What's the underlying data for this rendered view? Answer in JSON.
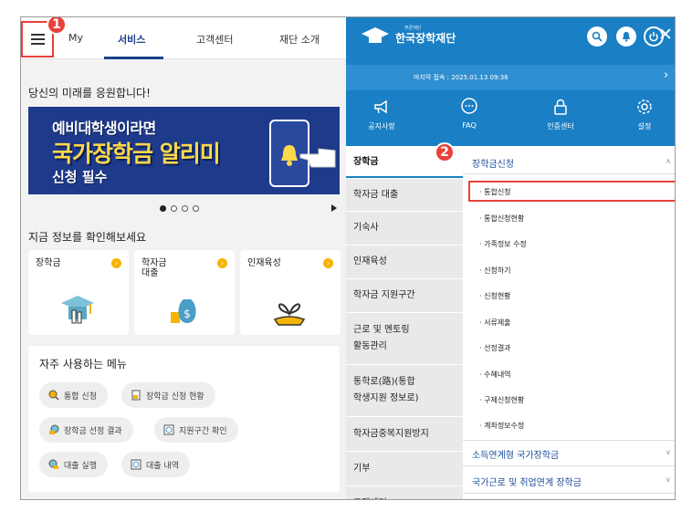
{
  "left": {
    "nav": {
      "tabs": [
        "My",
        "서비스",
        "고객센터",
        "재단 소개"
      ],
      "active": "서비스"
    },
    "step1_badge": "1",
    "headline": "당신의 미래를 응원합니다!",
    "banner": {
      "line1": "예비대학생이라면",
      "line2": "국가장학금 알리미",
      "line3": "신청 필수"
    },
    "carousel": {
      "pages": 4,
      "current": 1
    },
    "info_title": "지금 정보를 확인해보세요",
    "cards": [
      {
        "label": "장학금",
        "icon": "graduation-cap-icon"
      },
      {
        "label": "학자금\n대출",
        "icon": "money-bag-icon"
      },
      {
        "label": "인재육성",
        "icon": "sprout-hand-icon"
      }
    ],
    "freq_menu": {
      "title": "자주 사용하는 메뉴",
      "chips": [
        "통합 신청",
        "장학금 신청 현황",
        "장학금 선정 결과",
        "지원구간 확인",
        "대출 실행",
        "대출 내역"
      ]
    }
  },
  "right": {
    "logo": {
      "small": "푸른재단",
      "name": "한국장학재단"
    },
    "last_login": "마지막 접속 : 2025.01.13 09:36",
    "quick_links": [
      "공지사항",
      "FAQ",
      "인증센터",
      "설정"
    ],
    "step2_badge": "2",
    "categories": [
      "장학금",
      "학자금 대출",
      "기숙사",
      "인재육성",
      "학자금 지원구간",
      "근로 및 멘토링\n활동관리",
      "통학로(路)(통합\n학생지원 정보로)",
      "학자금중복지원방지",
      "기부",
      "고객센터"
    ],
    "selected_category": "장학금",
    "group1": "장학금신청",
    "group1_items": [
      "통합신청",
      "통합신청현황",
      "가족정보 수정",
      "신청하기",
      "신청현황",
      "서류제출",
      "선정결과",
      "수혜내역",
      "구제신청현황",
      "계좌정보수정"
    ],
    "highlighted_item": "통합신청",
    "group2": "소득연계형 국가장학금",
    "group3": "국가근로 및 취업연계 장학금",
    "colors": {
      "header_blue": "#1a7fc4",
      "highlight_red": "#e8403a",
      "nav_blue": "#1b3f8c"
    }
  }
}
